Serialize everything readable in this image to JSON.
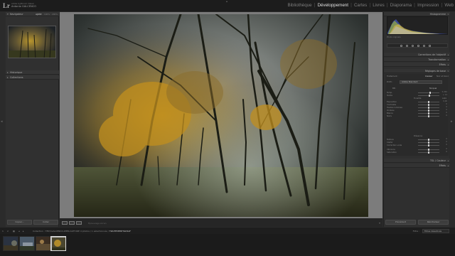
{
  "app": {
    "logo_text": "Lr",
    "identity_small": "Adobe Lightroom Classic",
    "identity_name": "Antonio GALCENCO"
  },
  "modules": [
    {
      "label": "Bibliothèque",
      "active": false
    },
    {
      "label": "Développement",
      "active": true
    },
    {
      "label": "Cartes",
      "active": false
    },
    {
      "label": "Livres",
      "active": false
    },
    {
      "label": "Diaporama",
      "active": false
    },
    {
      "label": "Impression",
      "active": false
    },
    {
      "label": "Web",
      "active": false
    }
  ],
  "left_panel": {
    "navigator": {
      "label": "Navigateur",
      "opts": [
        "AJUST.",
        "100%",
        "200%"
      ]
    },
    "presets": {
      "label": "Historique"
    },
    "collections": {
      "label": "Collections"
    },
    "buttons": {
      "copy": "Copier...",
      "paste": "Coller"
    }
  },
  "toolbar": {
    "softproof_label": "Épreuvage écran"
  },
  "right_panel": {
    "histogram_label": "Histogramme",
    "readout": "Photo originale",
    "sections": [
      {
        "label": "Corrections de l'objectif"
      },
      {
        "label": "Transformation"
      },
      {
        "label": "Effets"
      },
      {
        "label": "Réglages de base"
      }
    ],
    "basic": {
      "treatment_label": "Traitement :",
      "treatment_options": [
        "Couleur",
        "Noir et blanc"
      ],
      "profile_label": "Profil :",
      "profile_value": "Adobe Standard",
      "wb_label": "BB :",
      "wb_value": "Tel quel",
      "tone_label": "Tonalité",
      "tone_auto": "Auto",
      "presence_label": "Présence",
      "sliders": [
        {
          "label": "Temp.",
          "value": "5 250",
          "pos": 0.55
        },
        {
          "label": "Teinte",
          "value": "+ 14",
          "pos": 0.52
        },
        {
          "label": "Exposition",
          "value": "0,00",
          "pos": 0.5
        },
        {
          "label": "Contraste",
          "value": "0",
          "pos": 0.5
        },
        {
          "label": "Hautes lumières",
          "value": "0",
          "pos": 0.5
        },
        {
          "label": "Ombres",
          "value": "0",
          "pos": 0.5
        },
        {
          "label": "Blancs",
          "value": "0",
          "pos": 0.5
        },
        {
          "label": "Noirs",
          "value": "0",
          "pos": 0.5
        },
        {
          "label": "Texture",
          "value": "0",
          "pos": 0.5
        },
        {
          "label": "Clarté",
          "value": "0",
          "pos": 0.5
        },
        {
          "label": "Correction voile",
          "value": "0",
          "pos": 0.5
        },
        {
          "label": "Vibrance",
          "value": "0",
          "pos": 0.5
        },
        {
          "label": "Saturation",
          "value": "0",
          "pos": 0.5
        }
      ]
    },
    "lower_sections": [
      {
        "label": "TSL / Couleur"
      },
      {
        "label": "Effets"
      }
    ],
    "buttons": {
      "previous": "Précédent",
      "reset": "Réinitialiser"
    }
  },
  "bottom_bar": {
    "screen1": "1",
    "screen2": "2",
    "path_prefix": "Collection : TEST-GALCENCO-WEB-CAPTURE",
    "path_count": "4 photos / 1 sélectionnée /",
    "filename": "TRAITEMENTSW.RAF",
    "filter_label": "Filtre :",
    "filter_value": "Filtres désactivés"
  },
  "filmstrip": {
    "thumbs": [
      {
        "name": "thumb-1",
        "selected": false
      },
      {
        "name": "thumb-2",
        "selected": false
      },
      {
        "name": "thumb-3",
        "selected": false
      },
      {
        "name": "thumb-4",
        "selected": true
      }
    ]
  },
  "colors": {
    "active_module": "#e0e0e0",
    "panel_bg": "#303030",
    "canvas_bg": "#7c7c7c"
  }
}
